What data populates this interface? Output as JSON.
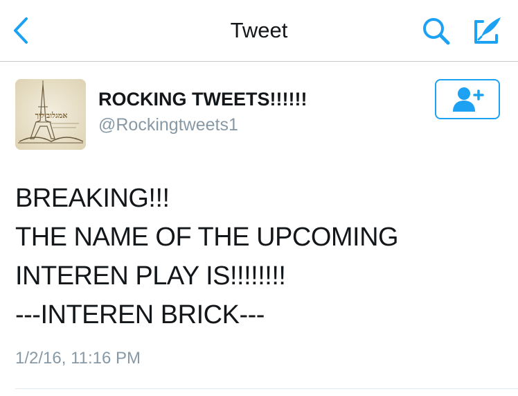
{
  "nav": {
    "title": "Tweet",
    "back_icon": "chevron-left-icon",
    "search_icon": "search-icon",
    "compose_icon": "compose-feather-icon"
  },
  "author": {
    "display_name": "ROCKING TWEETS!!!!!!",
    "username": "@Rockingtweets1",
    "avatar_icon": "eiffel-tower-avatar",
    "avatar_text": "אמגלוביליך"
  },
  "follow_button": {
    "icon": "add-user-icon"
  },
  "tweet": {
    "lines": [
      "BREAKING!!!",
      "THE NAME OF THE UPCOMING",
      "INTEREN PLAY IS!!!!!!!!",
      "---INTEREN BRICK---"
    ],
    "timestamp": "1/2/16, 11:16 PM"
  },
  "colors": {
    "accent": "#1da1f2",
    "secondary_text": "#8899a6",
    "primary_text": "#14171a",
    "divider": "#e1e8ed"
  }
}
